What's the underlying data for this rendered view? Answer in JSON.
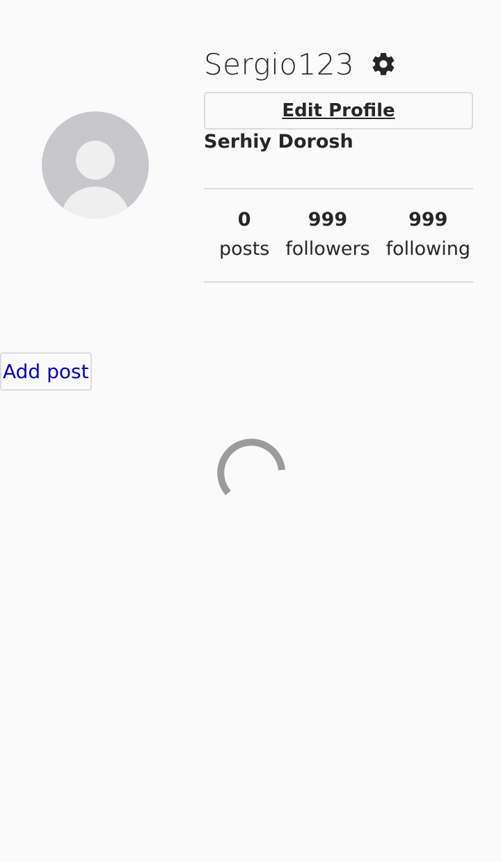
{
  "profile": {
    "username": "Sergio123",
    "full_name": "Serhiy Dorosh",
    "edit_profile_label": "Edit Profile",
    "settings_icon": "gear-icon",
    "avatar_icon": "default-avatar-icon"
  },
  "stats": [
    {
      "count": "0",
      "label": "posts"
    },
    {
      "count": "999",
      "label": "followers"
    },
    {
      "count": "999",
      "label": "following"
    }
  ],
  "actions": {
    "add_post_label": "Add post"
  },
  "loading": {
    "icon": "loading-spinner-icon"
  },
  "colors": {
    "background": "#fafafa",
    "text": "#262626",
    "border": "#dbdbdb",
    "link": "#0000c0",
    "avatar_bg": "#c7c7cc",
    "avatar_fg": "#efefef",
    "spinner": "#9b9b9b"
  }
}
